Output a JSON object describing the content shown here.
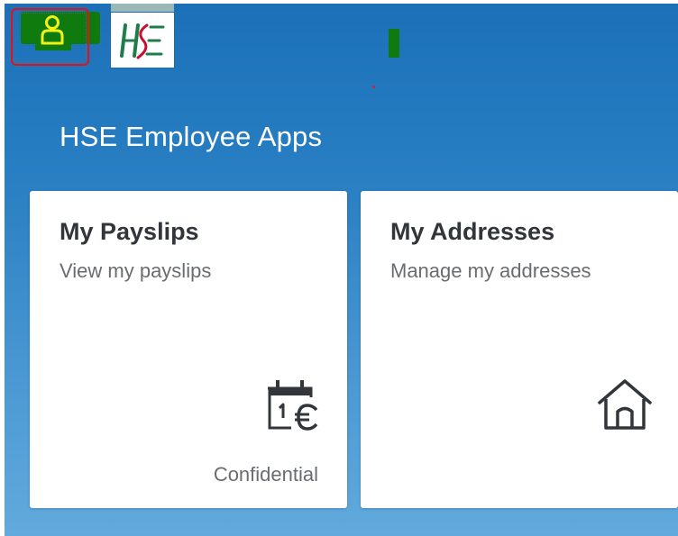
{
  "header": {
    "avatar_label": "User",
    "logo_text": "HSE"
  },
  "page": {
    "title": "HSE Employee Apps"
  },
  "tiles": [
    {
      "title": "My Payslips",
      "subtitle": "View my payslips",
      "icon": "payslip-calendar-euro-icon",
      "footer": "Confidential"
    },
    {
      "title": "My Addresses",
      "subtitle": "Manage my addresses",
      "icon": "home-icon",
      "footer": ""
    }
  ],
  "colors": {
    "shell_top": "#1b70b8",
    "shell_bottom": "#62aadd",
    "tile_text": "#32363a",
    "tile_subtext": "#6a6d70",
    "highlight_green": "#0f7b0f",
    "avatar_yellow": "#f2f21a",
    "logo_green": "#1e7d4a",
    "logo_red": "#c8102e"
  }
}
